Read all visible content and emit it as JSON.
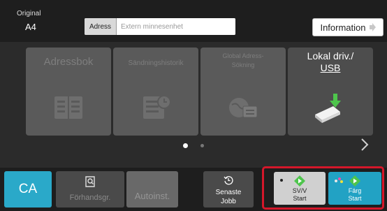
{
  "original": {
    "label": "Original",
    "value": "A4"
  },
  "address": {
    "label": "Adress",
    "placeholder": "Extern minnesenhet"
  },
  "info_button": {
    "label": "Information"
  },
  "tiles": {
    "address_book": "Adressbok",
    "send_history": "Sändningshistorik",
    "global_search_line1": "Global Adress-",
    "global_search_line2": "Sökning",
    "local_drive_line1": "Lokal driv./",
    "local_drive_line2": "USB"
  },
  "pager": {
    "current_page": 1,
    "total_pages": 2
  },
  "bottom": {
    "ca": "CA",
    "preview": "Förhandsgr.",
    "auto": "Autoinst.",
    "recent_line1": "Senaste",
    "recent_line2": "Jobb",
    "bw_line1": "SV/V",
    "bw_line2": "Start",
    "color_line1": "Färg",
    "color_line2": "Start"
  },
  "icons": {
    "next": "chevron-right-icon",
    "preview": "magnifier-document-icon",
    "recent": "history-icon",
    "start": "start-diamond-icon",
    "usb": "usb-download-icon",
    "address_book": "address-book-icon",
    "history": "history-list-icon",
    "global": "globe-card-icon"
  },
  "colors": {
    "accent": "#2aa9c9",
    "start_green": "#4ec54c",
    "highlight_frame": "#d5172a"
  }
}
